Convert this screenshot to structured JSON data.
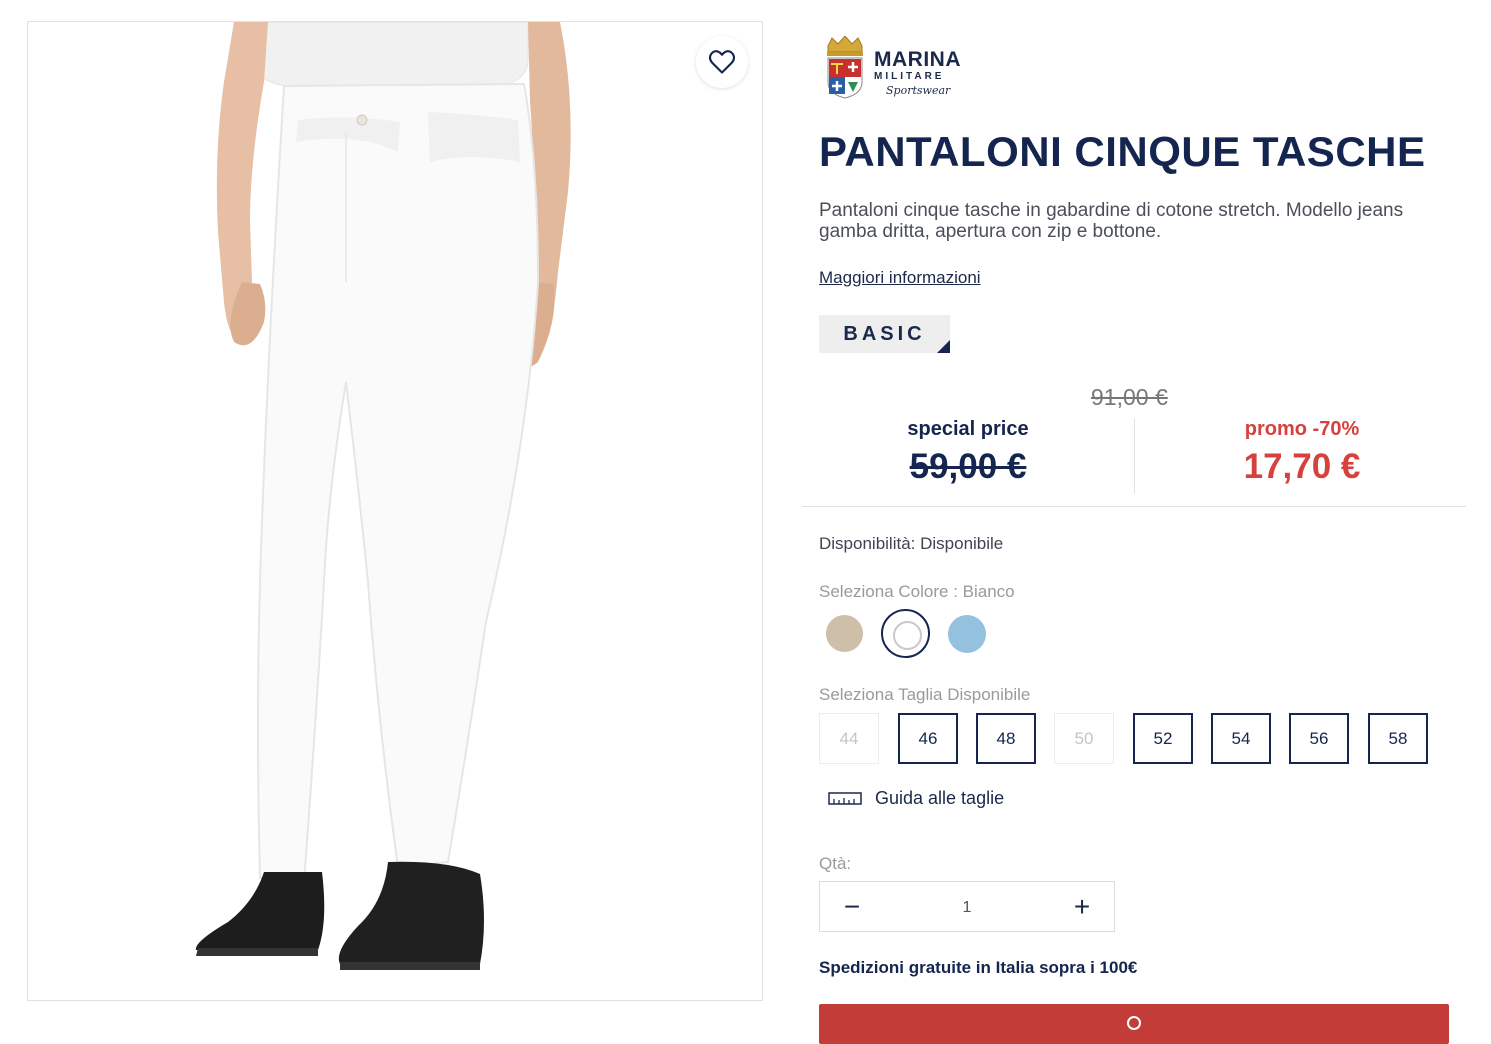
{
  "brand": {
    "line1": "MARINA",
    "line2": "MILITARE",
    "line3": "Sportswear"
  },
  "product": {
    "title": "PANTALONI CINQUE TASCHE",
    "description": "Pantaloni cinque tasche in gabardine di cotone stretch. Modello jeans gamba dritta, apertura con zip e bottone.",
    "more_info": "Maggiori informazioni",
    "badge": "BASIC"
  },
  "pricing": {
    "original": "91,00 €",
    "special_label": "special price",
    "special_value": "59,00 €",
    "promo_label": "promo -70%",
    "promo_value": "17,70 €"
  },
  "availability": "Disponibilità: Disponibile",
  "color": {
    "label": "Seleziona Colore : Bianco",
    "swatches": [
      {
        "name": "beige",
        "hex": "#cdbfa8",
        "selected": false
      },
      {
        "name": "bianco",
        "hex": "#ffffff",
        "selected": true
      },
      {
        "name": "azzurro",
        "hex": "#93c1de",
        "selected": false
      }
    ]
  },
  "sizes": {
    "label": "Seleziona Taglia Disponibile",
    "options": [
      {
        "value": "44",
        "available": false
      },
      {
        "value": "46",
        "available": true
      },
      {
        "value": "48",
        "available": true
      },
      {
        "value": "50",
        "available": false
      },
      {
        "value": "52",
        "available": true
      },
      {
        "value": "54",
        "available": true
      },
      {
        "value": "56",
        "available": true
      },
      {
        "value": "58",
        "available": true
      }
    ],
    "guide": "Guida alle taglie"
  },
  "quantity": {
    "label": "Qtà:",
    "value": "1",
    "minus": "−",
    "plus": "+"
  },
  "shipping": "Spedizioni gratuite in Italia sopra i 100€",
  "colors": {
    "navy": "#14264f",
    "promo_red": "#d6413d",
    "cart_red": "#c43c37"
  }
}
